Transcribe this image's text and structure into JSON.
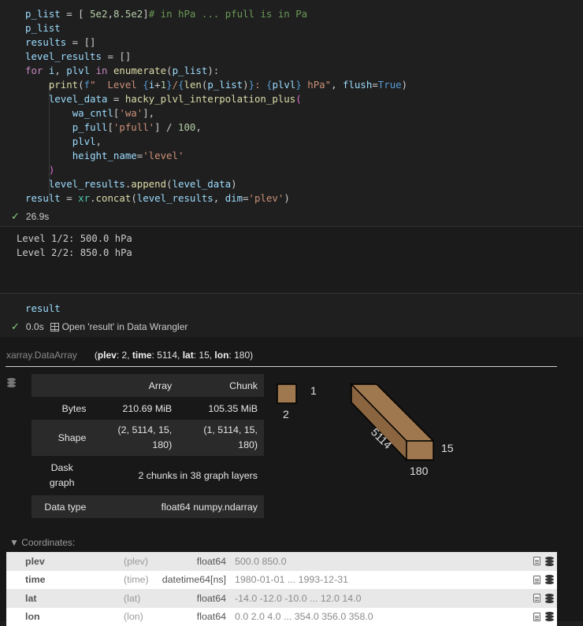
{
  "code_lines": [
    "p_list = [ 5e2,8.5e2]# in hPa ... pfull is in Pa",
    "p_list",
    "results = []",
    "level_results = []",
    "for i, plvl in enumerate(p_list):",
    "    print(f\"  Level {i+1}/{len(p_list)}: {plvl} hPa\", flush=True)",
    "    level_data = hacky_plvl_interpolation_plus(",
    "        wa_cntl['wa'],",
    "        p_full['pfull'] / 100,",
    "        plvl,",
    "        height_name='level'",
    "    )",
    "    level_results.append(level_data)",
    "result = xr.concat(level_results, dim='plev')"
  ],
  "cell1_status": {
    "time": "26.9s"
  },
  "output_lines": [
    "Level 1/2: 500.0 hPa",
    "Level 2/2: 850.0 hPa"
  ],
  "cell2": {
    "code": "result",
    "time": "0.0s",
    "wrangler": "Open 'result' in Data Wrangler"
  },
  "xarray": {
    "class_name": "xarray.DataArray",
    "dims_label": "(plev: 2, time: 5114, lat: 15, lon: 180)",
    "dims": [
      {
        "name": "plev",
        "size": "2"
      },
      {
        "name": "time",
        "size": "5114"
      },
      {
        "name": "lat",
        "size": "15"
      },
      {
        "name": "lon",
        "size": "180"
      }
    ],
    "table": {
      "headers": [
        "",
        "Array",
        "Chunk"
      ],
      "rows": [
        {
          "label": "Bytes",
          "array": "210.69 MiB",
          "chunk": "105.35 MiB"
        },
        {
          "label": "Shape",
          "array": "(2, 5114, 15, 180)",
          "chunk": "(1, 5114, 15, 180)"
        },
        {
          "label": "Dask graph",
          "span": "2 chunks in 38 graph layers"
        },
        {
          "label": "Data type",
          "span": "float64 numpy.ndarray"
        }
      ]
    },
    "cube_labels": {
      "small_top": "1",
      "small_bottom": "2",
      "big_right": "15",
      "big_bottom": "180",
      "big_diag": "5114"
    },
    "coords_header": "▼ Coordinates:",
    "coords": [
      {
        "name": "plev",
        "dims": "(plev)",
        "dtype": "float64",
        "values": "500.0 850.0"
      },
      {
        "name": "time",
        "dims": "(time)",
        "dtype": "datetime64[ns]",
        "values": "1980-01-01 ... 1993-12-31"
      },
      {
        "name": "lat",
        "dims": "(lat)",
        "dtype": "float64",
        "values": "-14.0 -12.0 -10.0 ... 12.0 14.0"
      },
      {
        "name": "lon",
        "dims": "(lon)",
        "dtype": "float64",
        "values": "0.0 2.0 4.0 ... 354.0 356.0 358.0"
      }
    ],
    "colors": {
      "cube_fill": "#a07850",
      "cube_stroke": "#000000"
    }
  }
}
